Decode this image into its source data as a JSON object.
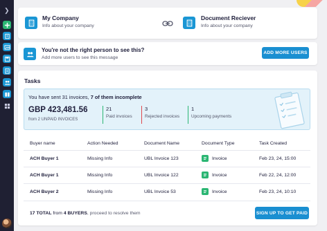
{
  "company": {
    "title": "My Company",
    "subtitle": "Info about your company"
  },
  "receiver": {
    "title": "Document Reciever",
    "subtitle": "Info about your company"
  },
  "notice": {
    "title": "You're not the right person to see this?",
    "subtitle": "Add more users to see this message",
    "button": "ADD MORE USERS"
  },
  "tasks": {
    "title": "Tasks",
    "summary_prefix": "You have sent 31 invoices, ",
    "summary_bold": "7 of them incomplete",
    "amount": "GBP 423,481.56",
    "amount_sub": "from 2 UNPAID INVOICES",
    "stats": [
      {
        "num": "21",
        "label": "Paid invoices",
        "color": "#2bb673"
      },
      {
        "num": "3",
        "label": "Rejected invoices",
        "color": "#e0474c"
      },
      {
        "num": "1",
        "label": "Upcoming payments",
        "color": "#2bb673"
      }
    ],
    "columns": [
      "Buyer name",
      "Action Needed",
      "Document Name",
      "Document Type",
      "Task Created"
    ],
    "rows": [
      {
        "buyer": "ACH Buyer 1",
        "action": "Missing Info",
        "doc": "UBL Invoice 123",
        "type": "Invoice",
        "created": "Feb 23, 24, 15:00"
      },
      {
        "buyer": "ACH Buyer 1",
        "action": "Missing Info",
        "doc": "UBL Invoice 122",
        "type": "Invoice",
        "created": "Feb 22, 24, 12:00"
      },
      {
        "buyer": "ACH Buyer 2",
        "action": "Missing Info",
        "doc": "UBL Invoice 53",
        "type": "Invoice",
        "created": "Feb 23, 24, 10:10"
      }
    ],
    "footer_total": "17 TOTAL",
    "footer_from": " from ",
    "footer_buyers": "4 BUYERS",
    "footer_rest": ", proceed to resolve them",
    "footer_button": "SIGN UP TO GET PAID"
  },
  "colors": {
    "accent": "#1a8fd1",
    "sidebar": "#1f2033",
    "green": "#2bb673",
    "red": "#e0474c"
  },
  "sidebar_icons": [
    "chevron-right-icon",
    "plus-icon",
    "building-icon",
    "image-icon",
    "save-icon",
    "clipboard-icon",
    "users-icon",
    "book-icon",
    "grid-icon"
  ]
}
